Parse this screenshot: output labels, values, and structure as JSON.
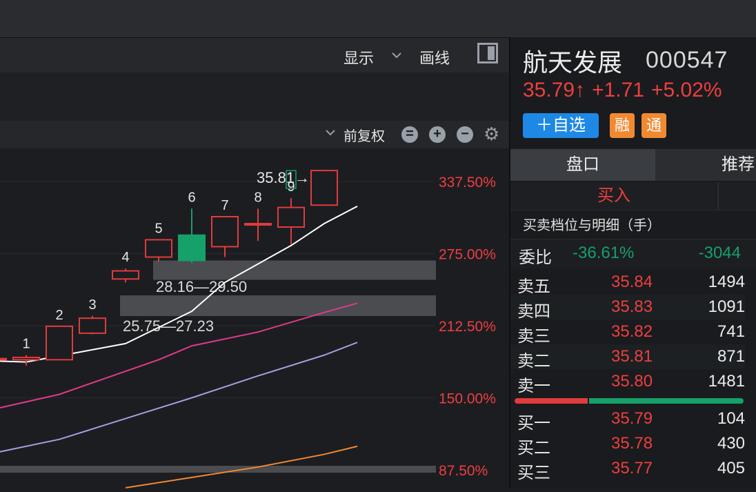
{
  "toolbar": {
    "display_label": "显示",
    "display_chevron": "chevron-down",
    "draw_label": "画线"
  },
  "chart_header": {
    "adjust_label": "前复权",
    "adjust_chevron": "chevron-down"
  },
  "chart_data": {
    "type": "candlestick",
    "y_axis_labels": [
      "337.50%",
      "275.00%",
      "212.50%",
      "150.00%",
      "87.50%"
    ],
    "y_ticks": [
      337.5,
      275.0,
      212.5,
      150.0,
      87.5
    ],
    "candles": [
      {
        "label": "",
        "open": 184,
        "close": 184,
        "high": 186,
        "low": 182,
        "color": "#e03c3c"
      },
      {
        "label": "1",
        "open": 183,
        "close": 185,
        "high": 187,
        "low": 178,
        "color": "#e03c3c"
      },
      {
        "label": "2",
        "open": 183,
        "close": 212,
        "high": 212,
        "low": 183,
        "color": "#e03c3c"
      },
      {
        "label": "3",
        "open": 206,
        "close": 219,
        "high": 221,
        "low": 205,
        "color": "#e03c3c"
      },
      {
        "label": "4",
        "open": 253,
        "close": 260,
        "high": 262,
        "low": 250,
        "color": "#e03c3c"
      },
      {
        "label": "5",
        "open": 272,
        "close": 287,
        "high": 287,
        "low": 268,
        "color": "#e03c3c"
      },
      {
        "label": "6",
        "open": 291,
        "close": 269,
        "high": 314,
        "low": 267,
        "color": "#16a06a"
      },
      {
        "label": "7",
        "open": 281,
        "close": 307,
        "high": 307,
        "low": 272,
        "color": "#e03c3c"
      },
      {
        "label": "8",
        "open": 301,
        "close": 301,
        "high": 314,
        "low": 286,
        "color": "#e03c3c"
      },
      {
        "label": "9",
        "open": 298,
        "close": 315,
        "high": 323,
        "low": 283,
        "color": "#e03c3c"
      },
      {
        "label": "",
        "open": 317,
        "close": 347,
        "high": 347,
        "low": 317,
        "color": "#e03c3c"
      }
    ],
    "moving_averages": [
      {
        "color": "#ffffff",
        "points": [
          [
            0,
            182
          ],
          [
            1,
            181
          ],
          [
            4,
            197
          ],
          [
            6,
            225
          ],
          [
            7,
            250
          ],
          [
            9,
            282
          ],
          [
            10,
            301
          ],
          [
            11,
            316
          ]
        ]
      },
      {
        "color": "#e23a8a",
        "points": [
          [
            0,
            140
          ],
          [
            2,
            153
          ],
          [
            5,
            183
          ],
          [
            6,
            195
          ],
          [
            8,
            207
          ],
          [
            10,
            224
          ],
          [
            11,
            232
          ]
        ]
      },
      {
        "color": "#a99ce0",
        "points": [
          [
            0,
            102
          ],
          [
            2,
            114
          ],
          [
            4,
            132
          ],
          [
            6,
            150
          ],
          [
            8,
            169
          ],
          [
            10,
            187
          ],
          [
            11,
            198
          ]
        ]
      },
      {
        "color": "#f08a32",
        "points": [
          [
            4,
            72
          ],
          [
            6,
            81
          ],
          [
            8,
            90
          ],
          [
            10,
            101
          ],
          [
            11,
            108
          ]
        ]
      }
    ],
    "price_zones": [
      "28.16—29.50",
      "25.75—27.23"
    ],
    "max_label": "35.81→"
  },
  "stock": {
    "name": "航天发展",
    "code": "000547",
    "price": "35.79↑",
    "change": "+1.71",
    "change_pct": "+5.02%",
    "add_watch": "＋自选",
    "badge_margin": "融",
    "badge_connect": "通"
  },
  "panel_tabs": [
    "盘口",
    "推荐"
  ],
  "buy_label": "买入",
  "detail_title": "买卖档位与明细（手）",
  "weibi": {
    "label": "委比",
    "pct": "-36.61%",
    "diff": "-3044"
  },
  "asks": [
    {
      "label": "卖五",
      "price": "35.84",
      "volume": "1494"
    },
    {
      "label": "卖四",
      "price": "35.83",
      "volume": "1091"
    },
    {
      "label": "卖三",
      "price": "35.82",
      "volume": "741"
    },
    {
      "label": "卖二",
      "price": "35.81",
      "volume": "871"
    },
    {
      "label": "卖一",
      "price": "35.80",
      "volume": "1481"
    }
  ],
  "bids": [
    {
      "label": "买一",
      "price": "35.79",
      "volume": "104"
    },
    {
      "label": "买二",
      "price": "35.78",
      "volume": "430"
    },
    {
      "label": "买三",
      "price": "35.77",
      "volume": "405"
    }
  ],
  "buy_sell_ratio": 0.32
}
